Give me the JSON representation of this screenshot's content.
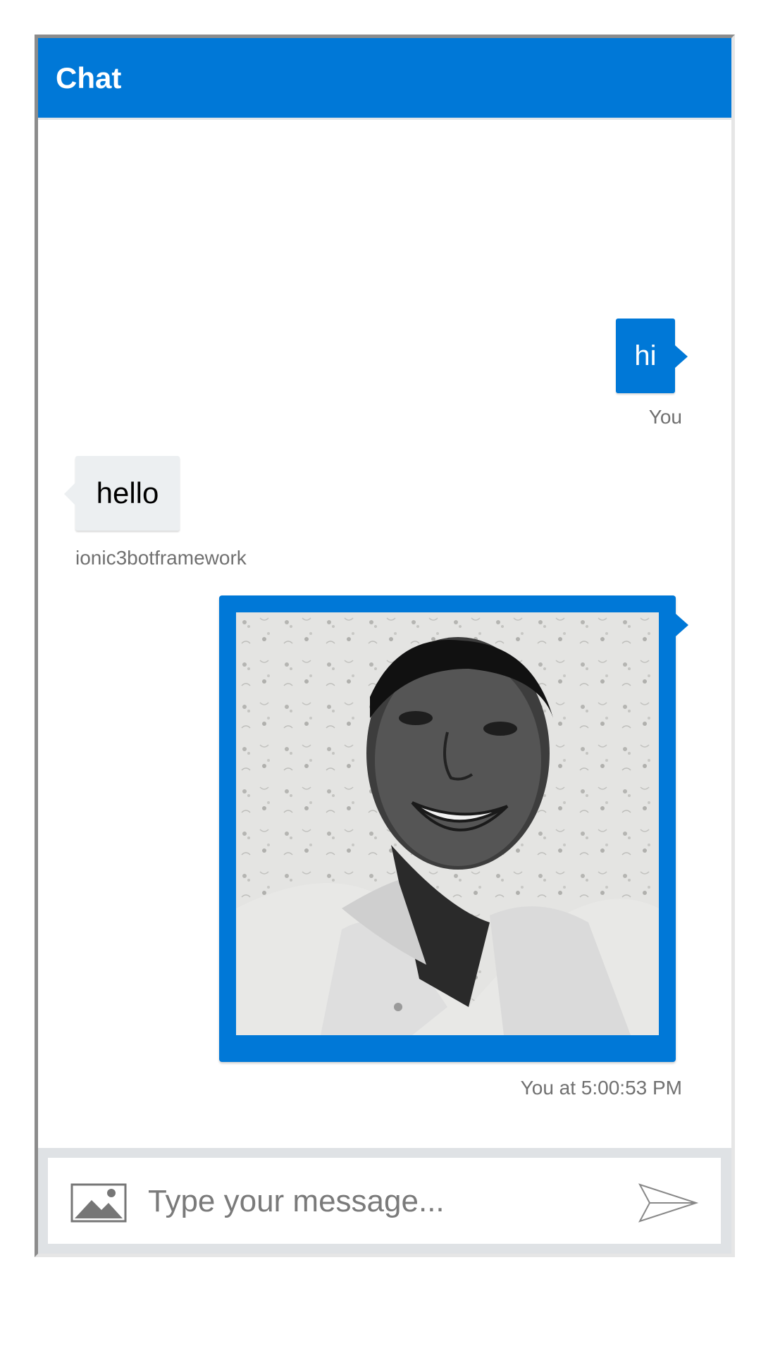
{
  "header": {
    "title": "Chat"
  },
  "messages": [
    {
      "from": "user",
      "text": "hi",
      "sender_label": "You"
    },
    {
      "from": "bot",
      "text": "hello",
      "sender_label": "ionic3botframework"
    },
    {
      "from": "user",
      "type": "image",
      "sender_label": "You at 5:00:53 PM"
    }
  ],
  "composer": {
    "placeholder": "Type your message...",
    "upload_icon": "image-icon",
    "send_icon": "send-icon"
  },
  "colors": {
    "accent": "#0078d7",
    "bot_bubble": "#eceff1",
    "sender_text": "#707070"
  }
}
